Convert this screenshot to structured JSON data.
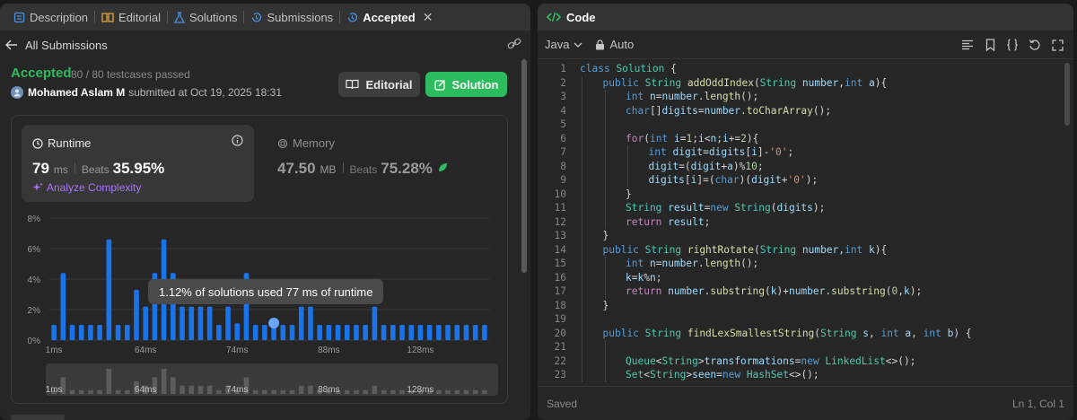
{
  "tabs": [
    {
      "label": "Description",
      "icon": "description-icon"
    },
    {
      "label": "Editorial",
      "icon": "book-icon"
    },
    {
      "label": "Solutions",
      "icon": "flask-icon"
    },
    {
      "label": "Submissions",
      "icon": "history-icon"
    },
    {
      "label": "Accepted",
      "icon": "history-icon",
      "active": true
    }
  ],
  "subheader": {
    "back_label": "All Submissions"
  },
  "submission": {
    "status": "Accepted",
    "testcases": "80 / 80 testcases passed",
    "author": "Mohamed Aslam M",
    "submitted_at": "submitted at Oct 19, 2025 18:31"
  },
  "buttons": {
    "editorial": "Editorial",
    "solution": "Solution"
  },
  "runtime": {
    "label": "Runtime",
    "value": "79",
    "unit": "ms",
    "beats_label": "Beats",
    "beats": "35.95%",
    "analyze": "Analyze Complexity"
  },
  "memory": {
    "label": "Memory",
    "value": "47.50",
    "unit": "MB",
    "beats_label": "Beats",
    "beats": "75.28%"
  },
  "tooltip": "1.12% of solutions used 77 ms of runtime",
  "colors": {
    "accent_green": "#2cbb5d",
    "bar_blue": "#1a73e8",
    "analyze_purple": "#a875ff",
    "bg_panel": "#262626"
  },
  "chart_data": {
    "type": "bar",
    "ylim": [
      0,
      8
    ],
    "y_ticks": [
      "8%",
      "6%",
      "4%",
      "2%",
      "0%"
    ],
    "x_tick_labels": [
      "1ms",
      "64ms",
      "74ms",
      "88ms",
      "128ms"
    ],
    "values": [
      1.0,
      4.4,
      1.0,
      1.0,
      1.0,
      1.0,
      6.6,
      1.0,
      1.0,
      3.3,
      2.2,
      4.4,
      6.6,
      4.4,
      2.2,
      2.2,
      2.2,
      2.2,
      1.0,
      2.2,
      1.1,
      4.4,
      1.0,
      1.0,
      1.0,
      1.0,
      1.0,
      2.2,
      2.2,
      1.0,
      1.0,
      1.0,
      1.0,
      1.0,
      1.0,
      2.2,
      1.0,
      1.0,
      1.0,
      1.0,
      1.0,
      1.0,
      1.0,
      1.0,
      1.0,
      1.0,
      1.0,
      1.0
    ],
    "highlighted_index": 24
  },
  "code_panel": {
    "title": "Code",
    "language": "Java",
    "mode": "Auto",
    "status_left": "Saved",
    "status_right": "Ln 1, Col 1"
  },
  "code_lines": [
    {
      "n": "1",
      "indent": 0,
      "html": "<span class='k'>class</span> <span class='t'>Solution</span> {"
    },
    {
      "n": "2",
      "indent": 1,
      "html": "<span class='k'>public</span> <span class='t'>String</span> <span class='f'>addOddIndex</span>(<span class='t'>String</span> <span class='v'>number</span>,<span class='k'>int</span> <span class='v'>a</span>){"
    },
    {
      "n": "3",
      "indent": 2,
      "html": "<span class='k'>int</span> <span class='v'>n</span>=<span class='v'>number</span>.<span class='f'>length</span>();"
    },
    {
      "n": "4",
      "indent": 2,
      "html": "<span class='k'>char</span>[]<span class='v'>digits</span>=<span class='v'>number</span>.<span class='f'>toCharArray</span>();"
    },
    {
      "n": "5",
      "indent": 0,
      "html": ""
    },
    {
      "n": "6",
      "indent": 2,
      "html": "<span class='kw2'>for</span>(<span class='k'>int</span> <span class='v'>i</span>=<span class='n'>1</span>;<span class='v'>i</span>&lt;<span class='v'>n</span>;<span class='v'>i</span>+=<span class='n'>2</span>){"
    },
    {
      "n": "7",
      "indent": 3,
      "html": "<span class='k'>int</span> <span class='v'>digit</span>=<span class='v'>digits</span>[<span class='v'>i</span>]-<span class='s'>'0'</span>;"
    },
    {
      "n": "8",
      "indent": 3,
      "html": "<span class='v'>digit</span>=(<span class='v'>digit</span>+<span class='v'>a</span>)%<span class='n'>10</span>;"
    },
    {
      "n": "9",
      "indent": 3,
      "html": "<span class='v'>digits</span>[<span class='v'>i</span>]=(<span class='k'>char</span>)(<span class='v'>digit</span>+<span class='s'>'0'</span>);"
    },
    {
      "n": "10",
      "indent": 2,
      "html": "}"
    },
    {
      "n": "11",
      "indent": 2,
      "html": "<span class='t'>String</span> <span class='v'>result</span>=<span class='k'>new</span> <span class='t'>String</span>(<span class='v'>digits</span>);"
    },
    {
      "n": "12",
      "indent": 2,
      "html": "<span class='kw2'>return</span> <span class='v'>result</span>;"
    },
    {
      "n": "13",
      "indent": 1,
      "html": "}"
    },
    {
      "n": "14",
      "indent": 1,
      "html": "<span class='k'>public</span> <span class='t'>String</span> <span class='f'>rightRotate</span>(<span class='t'>String</span> <span class='v'>number</span>,<span class='k'>int</span> <span class='v'>k</span>){"
    },
    {
      "n": "15",
      "indent": 2,
      "html": "<span class='k'>int</span> <span class='v'>n</span>=<span class='v'>number</span>.<span class='f'>length</span>();"
    },
    {
      "n": "16",
      "indent": 2,
      "html": "<span class='v'>k</span>=<span class='v'>k</span>%<span class='v'>n</span>;"
    },
    {
      "n": "17",
      "indent": 2,
      "html": "<span class='kw2'>return</span> <span class='v'>number</span>.<span class='f'>substring</span>(<span class='v'>k</span>)+<span class='v'>number</span>.<span class='f'>substring</span>(<span class='n'>0</span>,<span class='v'>k</span>);"
    },
    {
      "n": "18",
      "indent": 1,
      "html": "}"
    },
    {
      "n": "19",
      "indent": 0,
      "html": ""
    },
    {
      "n": "20",
      "indent": 1,
      "html": "<span class='k'>public</span> <span class='t'>String</span> <span class='f'>findLexSmallestString</span>(<span class='t'>String</span> <span class='v'>s</span>, <span class='k'>int</span> <span class='v'>a</span>, <span class='k'>int</span> <span class='v'>b</span>) {"
    },
    {
      "n": "21",
      "indent": 0,
      "html": ""
    },
    {
      "n": "22",
      "indent": 2,
      "html": "<span class='t'>Queue</span>&lt;<span class='t'>String</span>&gt;<span class='v'>transformations</span>=<span class='k'>new</span> <span class='t'>LinkedList</span>&lt;&gt;();"
    },
    {
      "n": "23",
      "indent": 2,
      "html": "<span class='t'>Set</span>&lt;<span class='t'>String</span>&gt;<span class='v'>seen</span>=<span class='k'>new</span> <span class='t'>HashSet</span>&lt;&gt;();"
    }
  ]
}
